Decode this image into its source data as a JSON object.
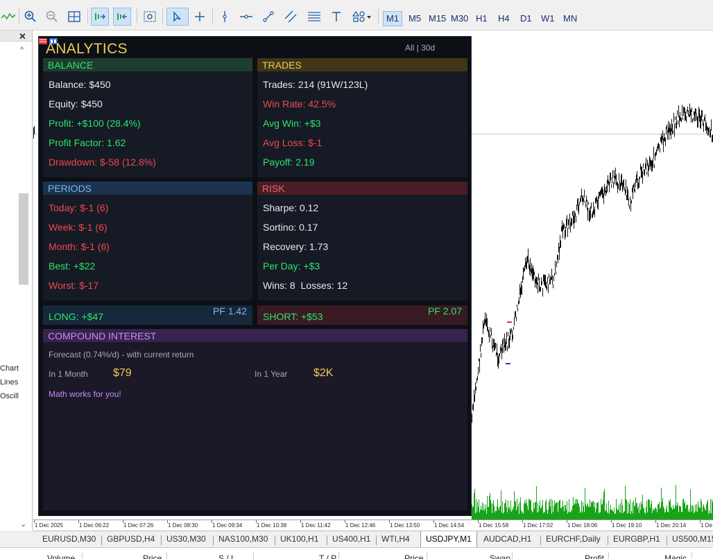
{
  "toolbar": {
    "timeframes": [
      "M1",
      "M5",
      "M15",
      "M30",
      "H1",
      "H4",
      "D1",
      "W1",
      "MN"
    ],
    "active_timeframe": "M1"
  },
  "navigator": {
    "close_glyph": "✕",
    "items": [
      "Chart",
      "Lines",
      "Oscill"
    ]
  },
  "analytics": {
    "title": "ANALYTICS",
    "filter": "All | 30d",
    "balance": {
      "header": "BALANCE",
      "lines": [
        "Balance: $450",
        "Equity: $450",
        "Profit: +$100 (28.4%)",
        "Profit Factor: 1.62",
        "Drawdown: $-58 (12.8%)"
      ]
    },
    "trades": {
      "header": "TRADES",
      "lines": [
        "Trades: 214 (91W/123L)",
        "Win Rate: 42.5%",
        "Avg Win: +$3",
        "Avg Loss: $-1",
        "Payoff: 2.19"
      ]
    },
    "periods": {
      "header": "PERIODS",
      "lines": [
        "Today: $-1 (6)",
        "Week: $-1 (6)",
        "Month: $-1 (6)",
        "Best: +$22",
        "Worst: $-17"
      ]
    },
    "risk": {
      "header": "RISK",
      "lines": [
        "Sharpe: 0.12",
        "Sortino: 0.17",
        "Recovery: 1.73",
        "Per Day: +$3",
        "Wins: 8  Losses: 12"
      ]
    },
    "long": {
      "label": "LONG: +$47",
      "pf": "PF 1.42"
    },
    "short": {
      "label": "SHORT: +$53",
      "pf": "PF 2.07"
    },
    "compound": {
      "header": "COMPOUND INTEREST",
      "forecast": "Forecast (0.74%/d) - with current return",
      "month_label": "In 1 Month",
      "month_value": "$79",
      "year_label": "In 1 Year",
      "year_value": "$2K",
      "note": "Math works for you!"
    },
    "colors": {
      "balance_header": "#1f3d2f",
      "trades_header": "#3f3618",
      "periods_header": "#1b3350",
      "risk_header": "#4a1c24",
      "long_bg": "#16283b",
      "short_bg": "#3a1a22",
      "compound_header": "#38234f",
      "compound_bg": "#1b1828"
    }
  },
  "time_axis": [
    "1 Dec 2025",
    "1 Dec 06:22",
    "1 Dec 07:26",
    "1 Dec 08:30",
    "1 Dec 09:34",
    "1 Dec 10:38",
    "1 Dec 11:42",
    "1 Dec 12:46",
    "1 Dec 13:50",
    "1 Dec 14:54",
    "1 Dec 15:58",
    "1 Dec 17:02",
    "1 Dec 18:06",
    "1 Dec 19:10",
    "1 Dec 20:14",
    "1 De"
  ],
  "symbol_tabs": [
    "EURUSD,M30",
    "GBPUSD,H4",
    "US30,M30",
    "NAS100,M30",
    "UK100,H1",
    "US400,H1",
    "WTI,H4",
    "USDJPY,M1",
    "AUDCAD,H1",
    "EURCHF,Daily",
    "EURGBP,H1",
    "US500,M15"
  ],
  "active_tab": "USDJPY,M1",
  "bottom_headers": [
    "Volume",
    "Price",
    "S / L",
    "T / P",
    "Price",
    "Swap",
    "Profit",
    "Magic"
  ]
}
